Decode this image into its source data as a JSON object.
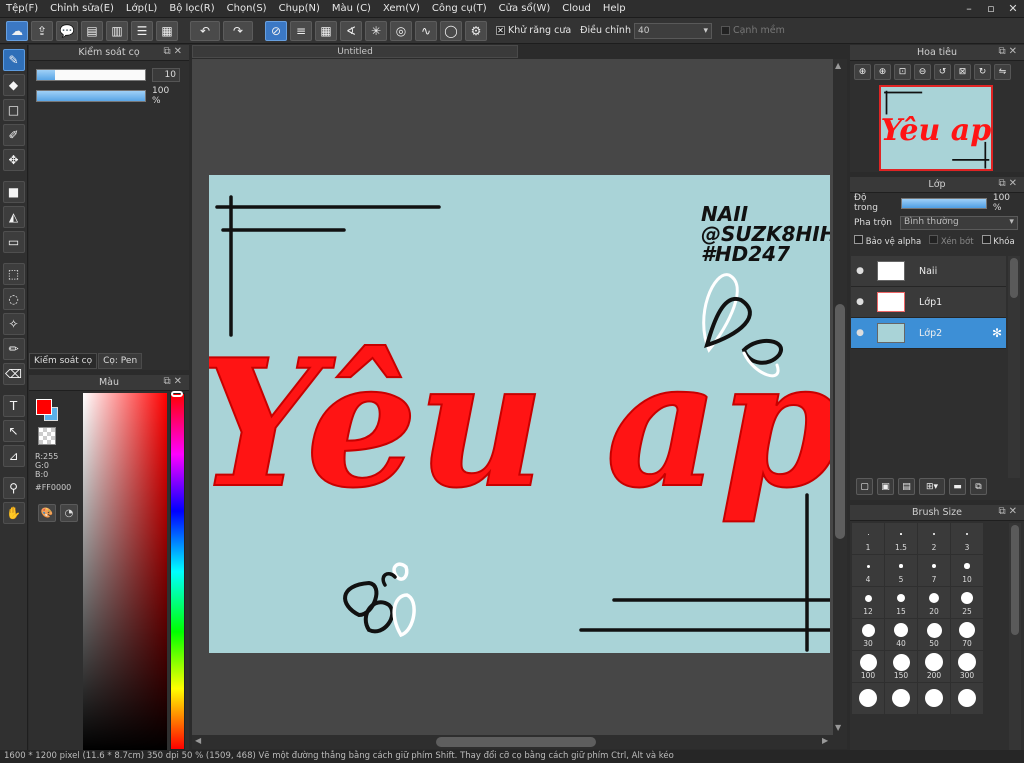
{
  "menu": [
    "Tệp(F)",
    "Chỉnh sửa(E)",
    "Lớp(L)",
    "Bộ lọc(R)",
    "Chọn(S)",
    "Chụp(N)",
    "Màu (C)",
    "Xem(V)",
    "Công cụ(T)",
    "Cửa sổ(W)",
    "Cloud",
    "Help"
  ],
  "toolbar": {
    "antialias_label": "Khử răng cưa",
    "correction_label": "Điều chỉnh",
    "correction_value": "40",
    "soft_edge_label": "Cạnh mềm"
  },
  "brush_control": {
    "title": "Kiểm soát cọ",
    "size_value": "10",
    "size_fraction": 0.17,
    "opacity_value": "100 %",
    "opacity_fraction": 1.0,
    "tabs": [
      "Kiểm soát cọ",
      "Cọ: Pen"
    ]
  },
  "color": {
    "title": "Màu",
    "r": "R:255",
    "g": "G:0",
    "b": "B:0",
    "hex": "#FF0000"
  },
  "document": {
    "tab_title": "Untitled"
  },
  "canvas_text": {
    "main": "Yêu ap",
    "watermark_1": "NAII",
    "watermark_2": "@SUZK8HIHI",
    "watermark_3": "#HD247"
  },
  "navigator": {
    "title": "Hoa tiêu"
  },
  "layers": {
    "title": "Lớp",
    "opacity_label": "Độ trong",
    "opacity_value": "100 %",
    "blend_label": "Pha trộn",
    "blend_value": "Bình thường",
    "protect_alpha": "Bảo vệ alpha",
    "clipping": "Xén bớt",
    "lock": "Khóa",
    "items": [
      {
        "name": "Naii",
        "selected": false
      },
      {
        "name": "Lớp1",
        "selected": false
      },
      {
        "name": "Lớp2",
        "selected": true
      }
    ]
  },
  "brush_size": {
    "title": "Brush Size",
    "sizes": [
      "1",
      "1.5",
      "2",
      "3",
      "4",
      "5",
      "7",
      "10",
      "12",
      "15",
      "20",
      "25",
      "30",
      "40",
      "50",
      "70",
      "100",
      "150",
      "200",
      "300",
      "",
      "",
      "",
      ""
    ]
  },
  "status": "1600 * 1200 pixel   (11.6 * 8.7cm)   350 dpi   50 %   (1509, 468)   Vẽ một đường thẳng bằng cách giữ phím Shift. Thay đổi cỡ cọ bằng cách giữ phím Ctrl, Alt và kéo"
}
